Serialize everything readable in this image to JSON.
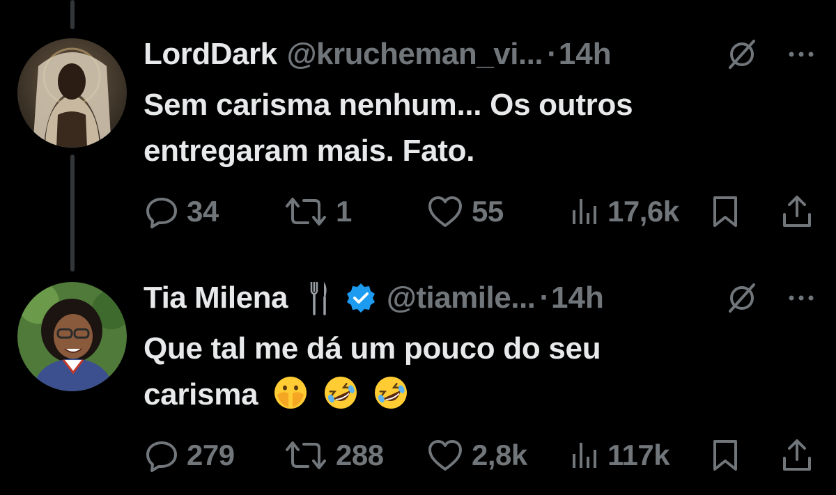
{
  "colors": {
    "background": "#000000",
    "primary_text": "#e7e9ea",
    "secondary_text": "#71767b",
    "verified_blue": "#1d9bf0",
    "thread_line": "#333639"
  },
  "tweets": [
    {
      "display_name": "LordDark",
      "handle": "@krucheman_vi...",
      "dot": "·",
      "time": "14h",
      "text_lines": [
        "Sem carisma nenhum... Os outros",
        "entregaram mais. Fato."
      ],
      "actions": {
        "replies": "34",
        "retweets": "1",
        "likes": "55",
        "views": "17,6k"
      }
    },
    {
      "display_name": "Tia Milena",
      "name_icon": "fork-knife-icon",
      "verified": true,
      "handle": "@tiamile...",
      "dot": "·",
      "time": "14h",
      "text_lines": [
        "Que tal me dá um pouco do seu",
        "carisma"
      ],
      "emojis": [
        "face-with-open-eyes-and-hand-over-mouth",
        "rolling-on-the-floor-laughing",
        "rolling-on-the-floor-laughing"
      ],
      "actions": {
        "replies": "279",
        "retweets": "288",
        "likes": "2,8k",
        "views": "117k"
      }
    }
  ]
}
